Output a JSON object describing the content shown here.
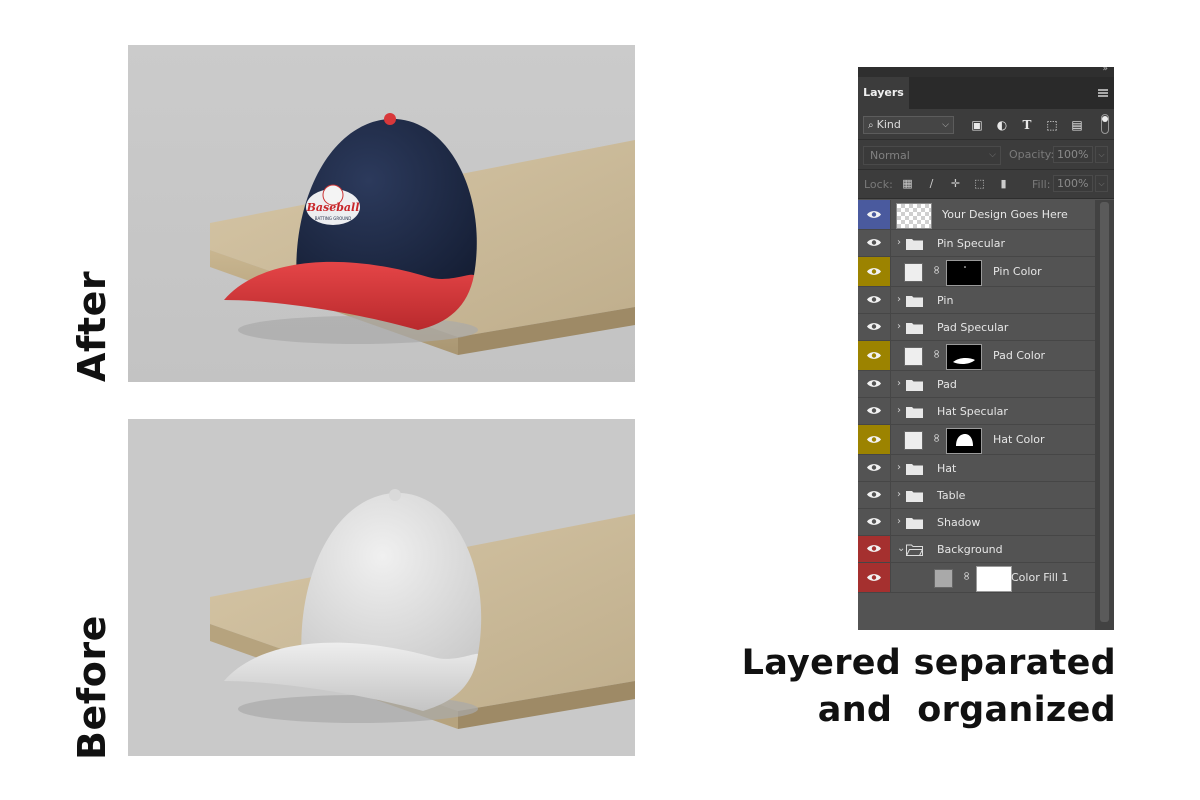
{
  "labels": {
    "after": "After",
    "before": "Before"
  },
  "caption": {
    "line1": "Layered separated",
    "line2": "and  organized"
  },
  "hat_logo": {
    "line1": "Baseball",
    "line2": "BATTING GROUND"
  },
  "colors": {
    "hat_crown": "#1f2b47",
    "hat_brim": "#d8383b",
    "hat_white": "#e6e6e6",
    "backdrop": "#c9c9c9",
    "wood": "#d2c0a0",
    "eye_blue": "#4a5a9e",
    "eye_olive": "#9c8300",
    "eye_red": "#a5302f"
  },
  "panel": {
    "tab_label": "Layers",
    "filter": {
      "label": "Kind",
      "icon": "search-icon"
    },
    "filter_icons": [
      "image-filter-icon",
      "adjustment-filter-icon",
      "type-filter-icon",
      "shape-filter-icon",
      "smart-object-filter-icon"
    ],
    "blend_mode": "Normal",
    "opacity_label": "Opacity:",
    "opacity_value": "100%",
    "lock_label": "Lock:",
    "lock_icons": [
      "lock-transparent-icon",
      "lock-image-icon",
      "lock-position-icon",
      "lock-artboard-icon",
      "lock-all-icon"
    ],
    "fill_label": "Fill:",
    "fill_value": "100%",
    "layers": [
      {
        "name": "Your Design Goes Here",
        "type": "smart",
        "eye": "blue"
      },
      {
        "name": "Pin Specular",
        "type": "group",
        "eye": "none"
      },
      {
        "name": "Pin Color",
        "type": "fill",
        "eye": "olive"
      },
      {
        "name": "Pin",
        "type": "group",
        "eye": "none"
      },
      {
        "name": "Pad Specular",
        "type": "group",
        "eye": "none"
      },
      {
        "name": "Pad Color",
        "type": "fill",
        "eye": "olive"
      },
      {
        "name": "Pad",
        "type": "group",
        "eye": "none"
      },
      {
        "name": "Hat Specular",
        "type": "group",
        "eye": "none"
      },
      {
        "name": "Hat Color",
        "type": "fill",
        "eye": "olive"
      },
      {
        "name": "Hat",
        "type": "group",
        "eye": "none"
      },
      {
        "name": "Table",
        "type": "group",
        "eye": "none"
      },
      {
        "name": "Shadow",
        "type": "group",
        "eye": "none"
      },
      {
        "name": "Background",
        "type": "group-open",
        "eye": "red"
      },
      {
        "name": "Color Fill 1",
        "type": "fill-child",
        "eye": "red"
      }
    ]
  }
}
